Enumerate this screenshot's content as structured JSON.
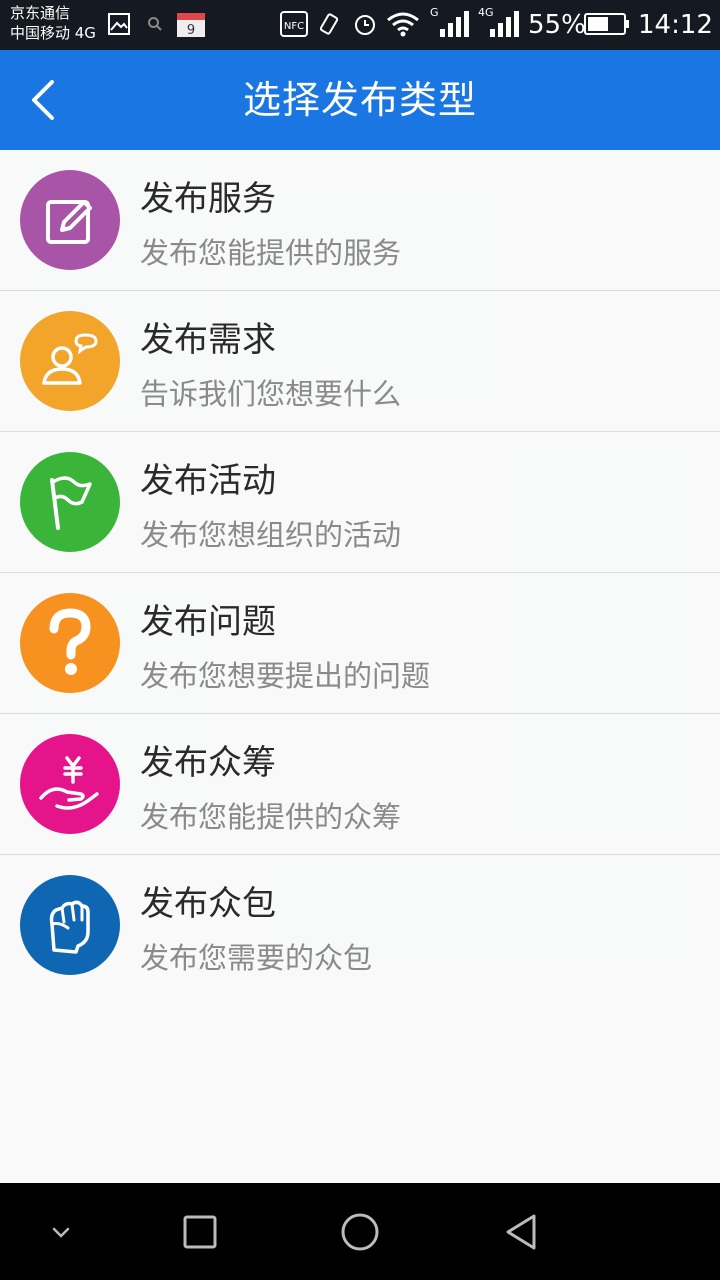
{
  "status_bar": {
    "carrier_line1": "京东通信",
    "carrier_line2": "中国移动 4G",
    "calendar_day": "9",
    "nfc": "NFC",
    "net1": "G",
    "net2": "4G",
    "battery": "55%",
    "time": "14:12"
  },
  "header": {
    "title": "选择发布类型"
  },
  "items": [
    {
      "title": "发布服务",
      "subtitle": "发布您能提供的服务",
      "color": "#a855a8",
      "icon": "edit-icon"
    },
    {
      "title": "发布需求",
      "subtitle": "告诉我们您想要什么",
      "color": "#f2a52a",
      "icon": "user-chat-icon"
    },
    {
      "title": "发布活动",
      "subtitle": "发布您想组织的活动",
      "color": "#3ab53a",
      "icon": "flag-icon"
    },
    {
      "title": "发布问题",
      "subtitle": "发布您想要提出的问题",
      "color": "#f7911f",
      "icon": "question-icon"
    },
    {
      "title": "发布众筹",
      "subtitle": "发布您能提供的众筹",
      "color": "#e5148a",
      "icon": "yuan-hand-icon"
    },
    {
      "title": "发布众包",
      "subtitle": "发布您需要的众包",
      "color": "#0f66b3",
      "icon": "fist-hand-icon"
    }
  ]
}
